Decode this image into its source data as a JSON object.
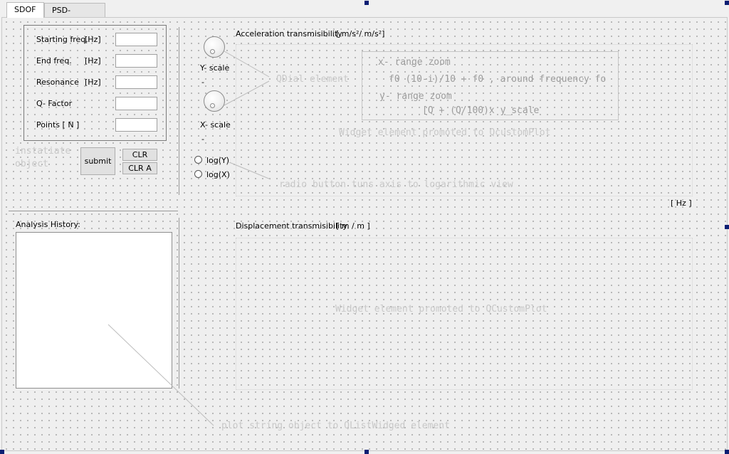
{
  "tabs": [
    {
      "label": "SDOF",
      "active": true
    },
    {
      "label": "PSD- Analysis",
      "active": false
    }
  ],
  "inputs_group": {
    "rows": [
      {
        "label": "Starting freq.",
        "unit": "[Hz]",
        "value": ""
      },
      {
        "label": "End freq.",
        "unit": "[Hz]",
        "value": ""
      },
      {
        "label": "Resonance",
        "unit": "[Hz]",
        "value": ""
      },
      {
        "label": "Q- Factor",
        "unit": "",
        "value": ""
      },
      {
        "label": "Points [ N ]",
        "unit": "",
        "value": ""
      }
    ]
  },
  "buttons": {
    "submit": "submit",
    "clr_scr": "CLR SCR",
    "clr_a": "CLR A"
  },
  "annotations": {
    "instantiate_line1": "instatiate",
    "instantiate_line2": "object",
    "qdial": "QDial element",
    "widget_top": "Widget element promoted to QcustomPlot",
    "radio_note": "radio button tuns axis to logarithmic view",
    "widget_bottom": "Widget element promoted to QCustomPlot",
    "list_note": "plot string object to QListWidged element"
  },
  "dials": {
    "y_scale_label": "Y- scale",
    "y_scale_value": "-",
    "x_scale_label": "X- scale",
    "x_scale_value": "-"
  },
  "radios": {
    "log_y": "log(Y)",
    "log_x": "log(X)"
  },
  "plots": {
    "accel_title": "Acceleration transmisibility",
    "accel_unit": "[ m/s²/ m/s²]",
    "hz_unit": "[ Hz ]",
    "disp_title": "Displacement transmisibility",
    "disp_unit": "[ m / m ]"
  },
  "zoom_note": {
    "line1": "x- range zoom",
    "line2": "f0 (10-i)/10 + f0 , around frequency fo",
    "line3": "y- range zoom",
    "line4": "[Q + (Q/100)x y_scale"
  },
  "history": {
    "label": "Analysis History:"
  }
}
